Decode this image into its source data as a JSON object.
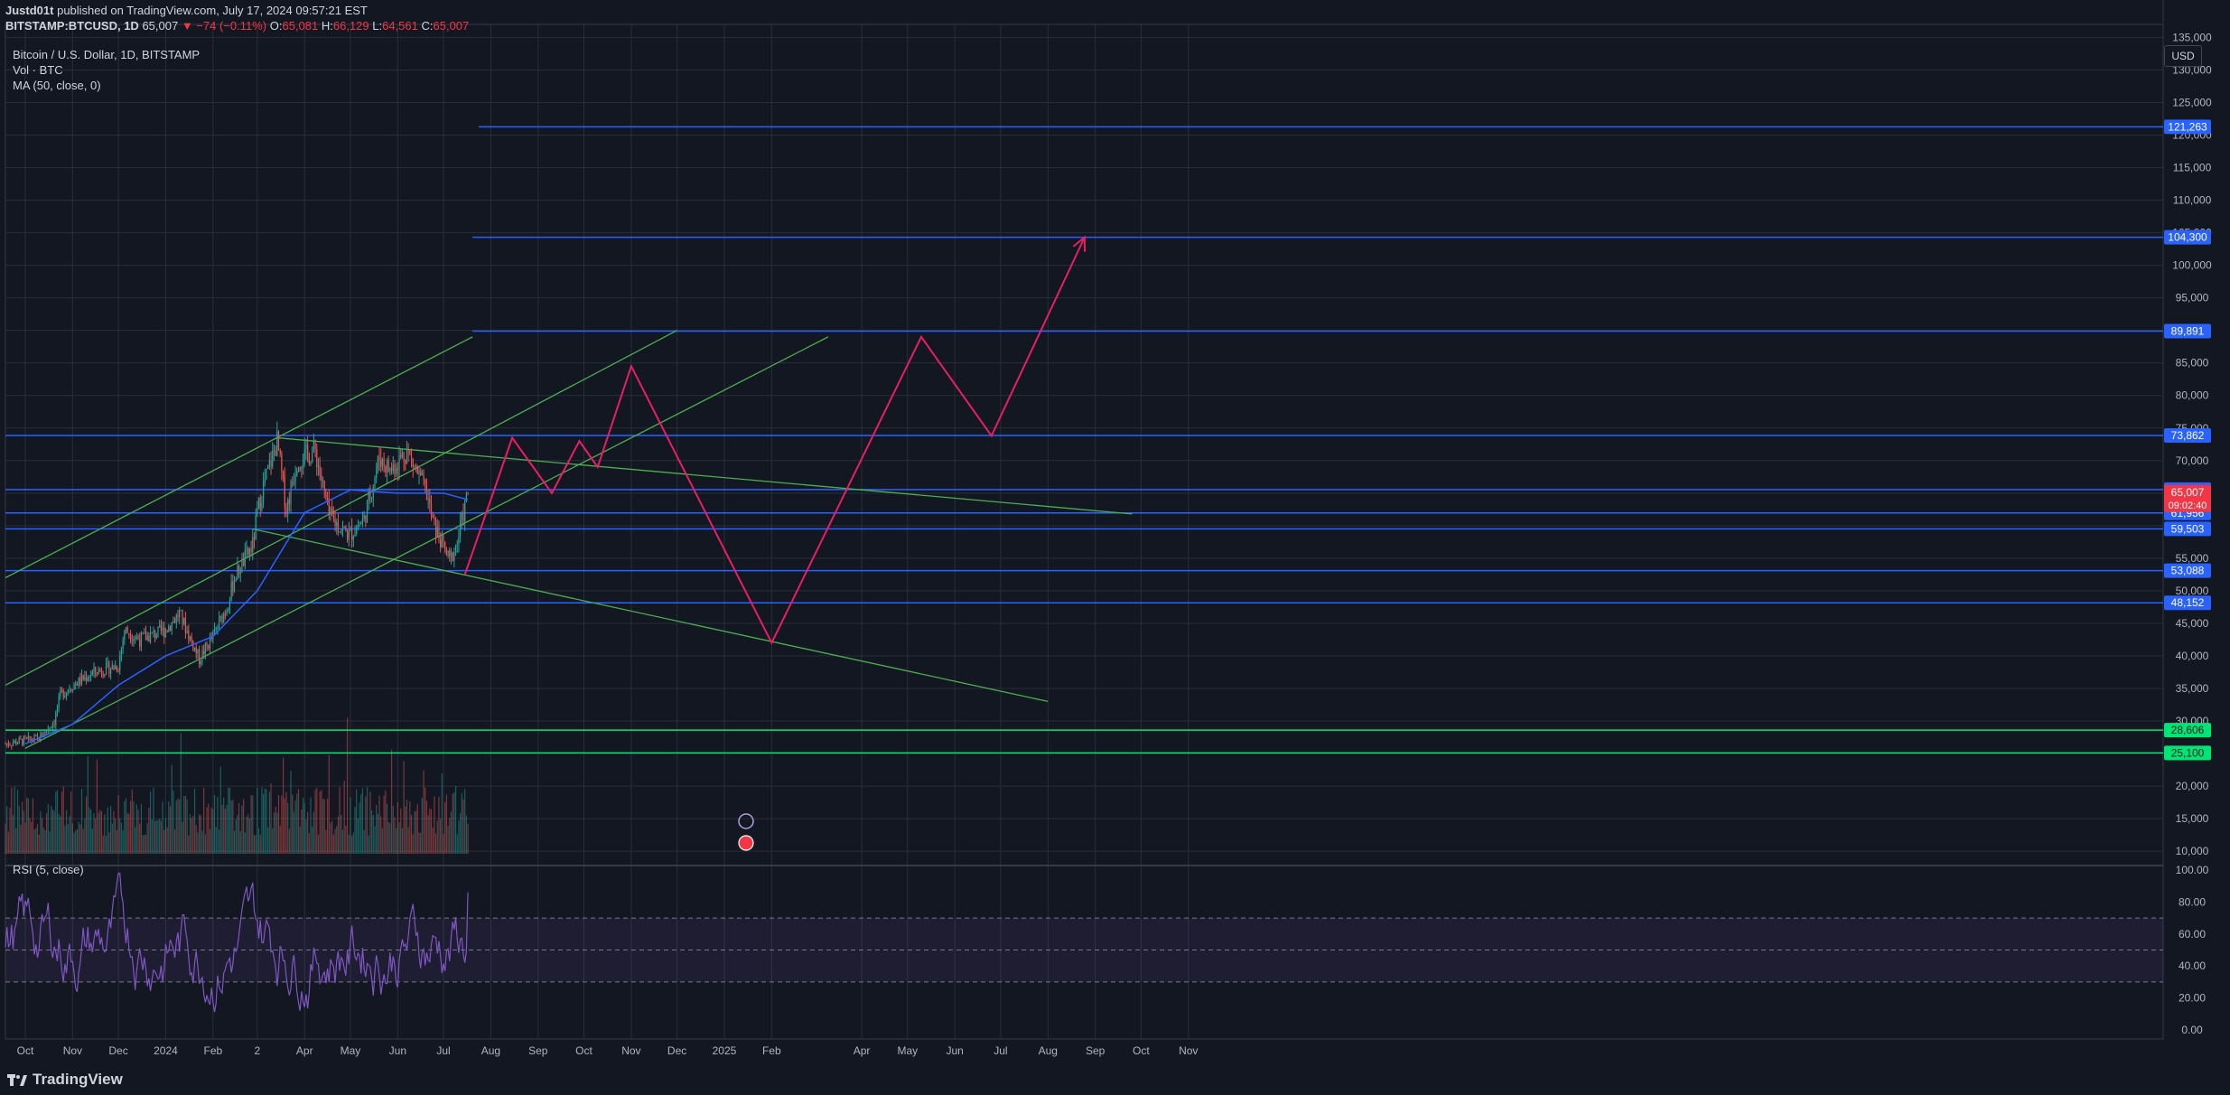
{
  "header": {
    "author": "Justd01t",
    "published": "published on TradingView.com, July 17, 2024 09:57:21 EST",
    "symbol": "BITSTAMP:BTCUSD, 1D",
    "last": "65,007",
    "change": "▼ −74 (−0.11%)",
    "open_label": "O:",
    "open": "65,081",
    "high_label": "H:",
    "high": "66,129",
    "low_label": "L:",
    "low": "64,561",
    "close_label": "C:",
    "close": "65,007"
  },
  "legend": {
    "title": "Bitcoin / U.S. Dollar, 1D, BITSTAMP",
    "volume": "Vol · BTC",
    "ma": "MA (50, close, 0)",
    "rsi": "RSI (5, close)"
  },
  "currency": "USD",
  "footer": {
    "brand": "TradingView"
  },
  "colors": {
    "bg": "#131722",
    "grid": "#2a2e39",
    "blue": "#2962ff",
    "green": "#4caf50",
    "bright_green": "#00e676",
    "pink": "#e91e63",
    "up": "#26a69a",
    "down": "#ef5350",
    "ma": "#2962ff",
    "rsi": "#7e57c2"
  },
  "chart_data": {
    "type": "candlestick",
    "title": "Bitcoin / U.S. Dollar, 1D, BITSTAMP",
    "x_ticks": [
      "Oct",
      "Nov",
      "Dec",
      "2024",
      "Feb",
      "2",
      "Apr",
      "May",
      "Jun",
      "Jul",
      "Aug",
      "Sep",
      "Oct",
      "Nov",
      "Dec",
      "2025",
      "Feb",
      "Apr",
      "May",
      "Jun",
      "Jul",
      "Aug",
      "Sep",
      "Oct",
      "Nov"
    ],
    "x_tick_dates": [
      "2023-10-01",
      "2023-11-01",
      "2023-12-01",
      "2024-01-01",
      "2024-02-01",
      "2024-03-01",
      "2024-04-01",
      "2024-05-01",
      "2024-06-01",
      "2024-07-01",
      "2024-08-01",
      "2024-09-01",
      "2024-10-01",
      "2024-11-01",
      "2024-12-01",
      "2025-01-01",
      "2025-02-01",
      "2025-04-01",
      "2025-05-01",
      "2025-06-01",
      "2025-07-01",
      "2025-08-01",
      "2025-09-01",
      "2025-10-01",
      "2025-11-01"
    ],
    "y_ticks": [
      10000,
      15000,
      20000,
      25000,
      30000,
      35000,
      40000,
      45000,
      50000,
      55000,
      60000,
      65000,
      70000,
      75000,
      80000,
      85000,
      90000,
      95000,
      100000,
      105000,
      110000,
      115000,
      120000,
      125000,
      130000,
      135000
    ],
    "ylim": [
      7800,
      137000
    ],
    "price_path": [
      [
        "2023-09-18",
        26500
      ],
      [
        "2023-10-01",
        27000
      ],
      [
        "2023-10-10",
        27300
      ],
      [
        "2023-10-20",
        30000
      ],
      [
        "2023-10-24",
        34000
      ],
      [
        "2023-11-01",
        35500
      ],
      [
        "2023-11-15",
        37500
      ],
      [
        "2023-12-01",
        38500
      ],
      [
        "2023-12-05",
        44000
      ],
      [
        "2023-12-15",
        42500
      ],
      [
        "2024-01-01",
        44000
      ],
      [
        "2024-01-10",
        46500
      ],
      [
        "2024-01-23",
        39500
      ],
      [
        "2024-02-01",
        43000
      ],
      [
        "2024-02-10",
        47500
      ],
      [
        "2024-02-15",
        52000
      ],
      [
        "2024-02-27",
        57000
      ],
      [
        "2024-03-01",
        62000
      ],
      [
        "2024-03-05",
        66000
      ],
      [
        "2024-03-14",
        73000
      ],
      [
        "2024-03-20",
        62500
      ],
      [
        "2024-03-27",
        70000
      ],
      [
        "2024-04-08",
        71500
      ],
      [
        "2024-04-17",
        61500
      ],
      [
        "2024-04-30",
        58500
      ],
      [
        "2024-05-10",
        61000
      ],
      [
        "2024-05-20",
        70500
      ],
      [
        "2024-05-27",
        68500
      ],
      [
        "2024-06-07",
        71500
      ],
      [
        "2024-06-20",
        65000
      ],
      [
        "2024-06-24",
        60500
      ],
      [
        "2024-07-05",
        54500
      ],
      [
        "2024-07-10",
        57500
      ],
      [
        "2024-07-17",
        65007
      ]
    ],
    "ma50_path": [
      [
        "2023-10-01",
        26500
      ],
      [
        "2023-11-01",
        29500
      ],
      [
        "2023-12-01",
        35500
      ],
      [
        "2024-01-01",
        40000
      ],
      [
        "2024-02-01",
        43000
      ],
      [
        "2024-03-01",
        50000
      ],
      [
        "2024-04-01",
        62000
      ],
      [
        "2024-05-01",
        65500
      ],
      [
        "2024-06-01",
        65000
      ],
      [
        "2024-07-01",
        65000
      ],
      [
        "2024-07-17",
        64000
      ]
    ],
    "horizontal_levels": [
      {
        "value": 121263,
        "color": "blue",
        "label": "121,263",
        "from": "2024-07-24"
      },
      {
        "value": 104300,
        "color": "blue",
        "label": "104,300",
        "from": "2024-07-20"
      },
      {
        "value": 89891,
        "color": "blue",
        "label": "89,891",
        "from": "2024-07-20"
      },
      {
        "value": 73862,
        "color": "blue",
        "label": "73,862"
      },
      {
        "value": 65553,
        "color": "blue",
        "label": "65,553"
      },
      {
        "value": 61956,
        "color": "blue",
        "label": "61,956"
      },
      {
        "value": 59503,
        "color": "blue",
        "label": "59,503"
      },
      {
        "value": 53088,
        "color": "blue",
        "label": "53,088"
      },
      {
        "value": 48152,
        "color": "blue",
        "label": "48,152"
      },
      {
        "value": 28606,
        "color": "bright_green",
        "label": "28,606"
      },
      {
        "value": 25100,
        "color": "bright_green",
        "label": "25,100"
      }
    ],
    "current_price": {
      "value": 65007,
      "label": "65,007",
      "countdown": "09:02:40"
    },
    "trendlines": [
      {
        "from": [
          "2023-09-18",
          52000
        ],
        "to": [
          "2024-07-20",
          89000
        ]
      },
      {
        "from": [
          "2023-09-18",
          35500
        ],
        "to": [
          "2024-12-01",
          90000
        ]
      },
      {
        "from": [
          "2023-10-01",
          25800
        ],
        "to": [
          "2025-03-10",
          89000
        ]
      },
      {
        "from": [
          "2024-03-14",
          73500
        ],
        "to": [
          "2025-09-25",
          61800
        ]
      },
      {
        "from": [
          "2024-02-27",
          59500
        ],
        "to": [
          "2025-08-01",
          33000
        ]
      }
    ],
    "projection_path": [
      [
        "2024-07-15",
        52500
      ],
      [
        "2024-08-15",
        73500
      ],
      [
        "2024-09-10",
        65000
      ],
      [
        "2024-09-28",
        73000
      ],
      [
        "2024-10-10",
        69000
      ],
      [
        "2024-11-01",
        84500
      ],
      [
        "2025-02-01",
        42000
      ],
      [
        "2025-05-10",
        89000
      ],
      [
        "2025-06-25",
        73800
      ],
      [
        "2025-08-25",
        104300
      ]
    ],
    "rsi": {
      "name": "RSI (5, close)",
      "y_ticks": [
        0,
        20,
        40,
        60,
        80,
        100
      ],
      "band_upper": 70,
      "band_lower": 30,
      "midline": 50,
      "last": 86
    },
    "volume": {
      "name": "Vol · BTC"
    }
  }
}
